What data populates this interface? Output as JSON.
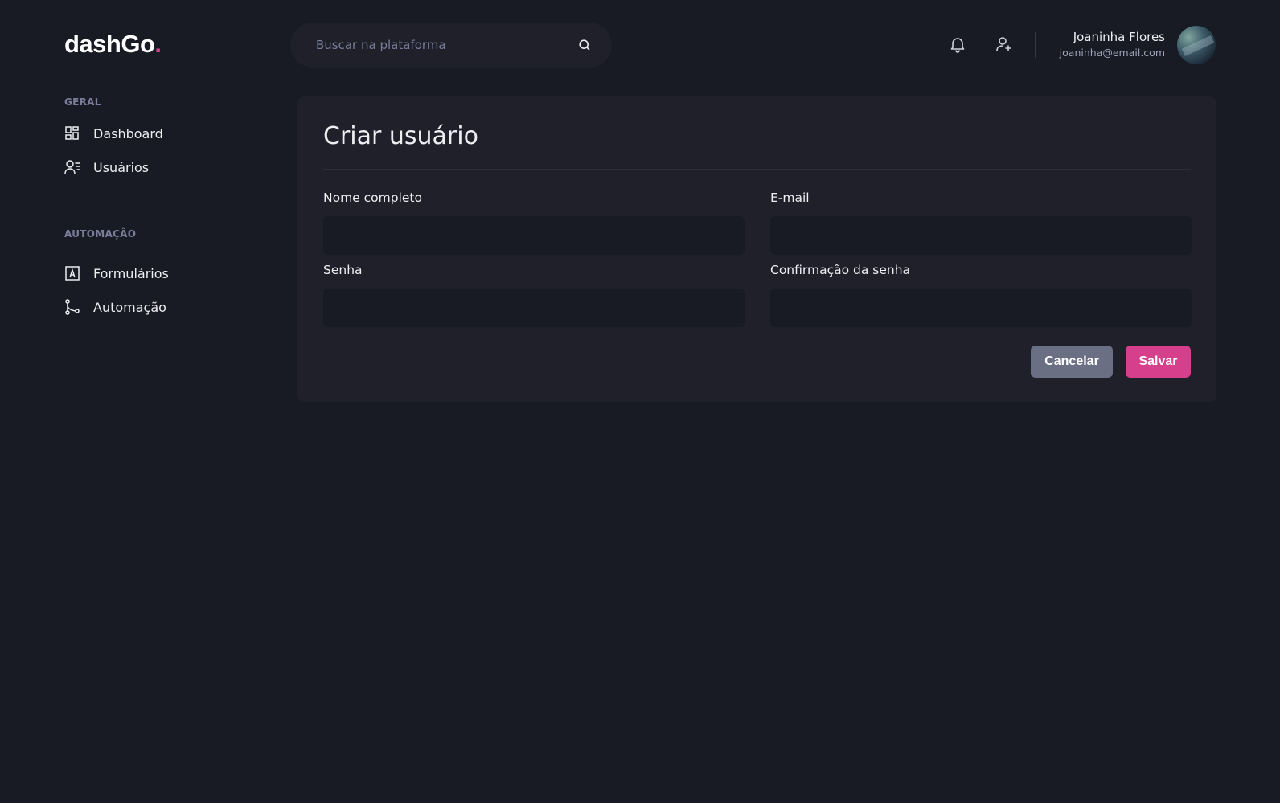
{
  "header": {
    "logo": "dashGo",
    "logo_dot": ".",
    "search_placeholder": "Buscar na plataforma",
    "user_name": "Joaninha Flores",
    "user_email": "joaninha@email.com"
  },
  "sidebar": {
    "sections": [
      {
        "title": "GERAL",
        "items": [
          {
            "label": "Dashboard",
            "icon": "dashboard-icon"
          },
          {
            "label": "Usuários",
            "icon": "users-icon"
          }
        ]
      },
      {
        "title": "AUTOMAÇÃO",
        "items": [
          {
            "label": "Formulários",
            "icon": "form-icon"
          },
          {
            "label": "Automação",
            "icon": "git-merge-icon"
          }
        ]
      }
    ]
  },
  "main": {
    "title": "Criar usuário",
    "fields": {
      "name_label": "Nome completo",
      "email_label": "E-mail",
      "password_label": "Senha",
      "password_confirm_label": "Confirmação da senha"
    },
    "buttons": {
      "cancel": "Cancelar",
      "save": "Salvar"
    }
  },
  "colors": {
    "background": "#181b23",
    "card": "#1f2029",
    "accent": "#d53f8c",
    "muted": "#797d9a",
    "cancel_button": "#6b6f83"
  }
}
